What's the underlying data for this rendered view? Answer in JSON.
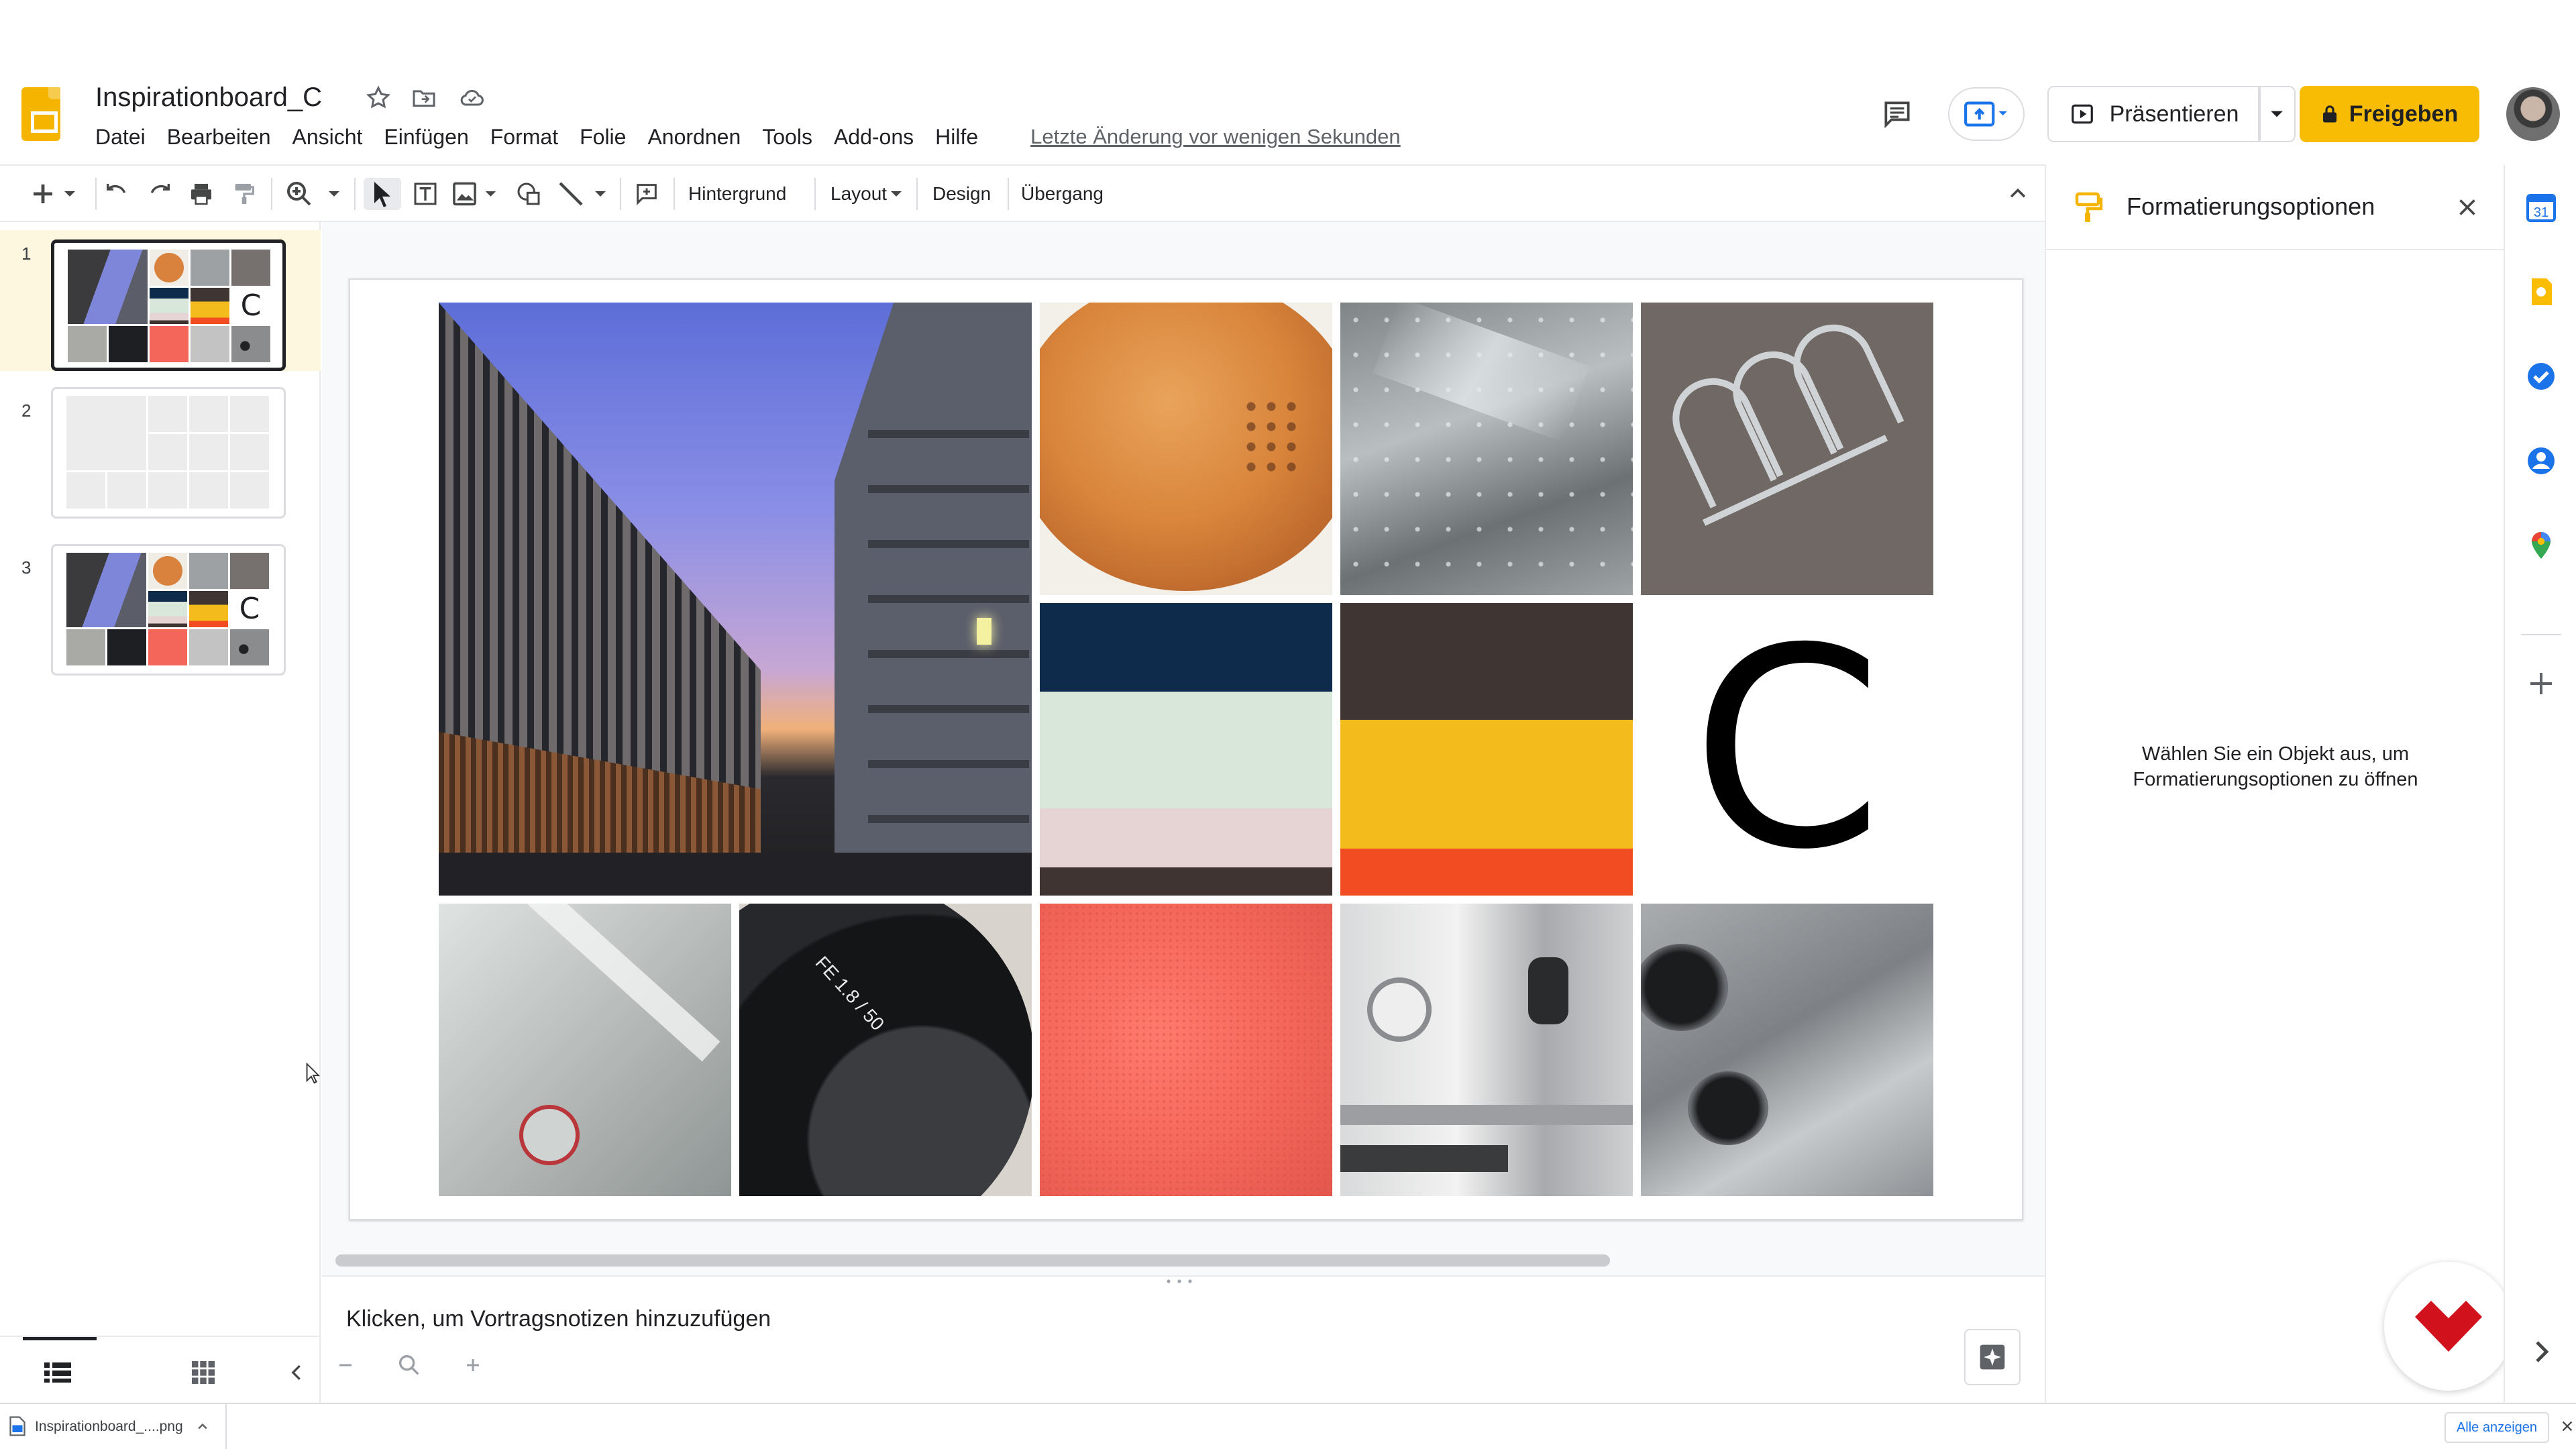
{
  "app": {
    "brand_color": "#f4b400"
  },
  "header": {
    "doc_title": "Inspirationboard_C",
    "menu": [
      "Datei",
      "Bearbeiten",
      "Ansicht",
      "Einfügen",
      "Format",
      "Folie",
      "Anordnen",
      "Tools",
      "Add-ons",
      "Hilfe"
    ],
    "last_edit": "Letzte Änderung vor wenigen Sekunden",
    "present_label": "Präsentieren",
    "share_label": "Freigeben",
    "share_color": "#f9bc05"
  },
  "toolbar": {
    "background_label": "Hintergrund",
    "layout_label": "Layout",
    "design_label": "Design",
    "transition_label": "Übergang"
  },
  "filmstrip": {
    "slides": [
      {
        "number": "1",
        "selected": true
      },
      {
        "number": "2",
        "selected": false
      },
      {
        "number": "3",
        "selected": false
      }
    ]
  },
  "slide": {
    "letter": "C",
    "lens_marking": "FE 1.8 / 50",
    "color_palette_1": [
      "#0f2b4c",
      "#d9e6da",
      "#e6d3d3",
      "#3f3431"
    ],
    "color_palette_2": [
      "#3f3532",
      "#f3bb1c",
      "#f24d22"
    ]
  },
  "notes": {
    "placeholder": "Klicken, um Vortragsnotizen hinzuzufügen"
  },
  "side_panel": {
    "title": "Formatierungsoptionen",
    "empty_message": "Wählen Sie ein Objekt aus, um Formatierungsoptionen zu öffnen"
  },
  "download_bar": {
    "file_name": "Inspirationboard_....png",
    "show_all": "Alle anzeigen"
  }
}
